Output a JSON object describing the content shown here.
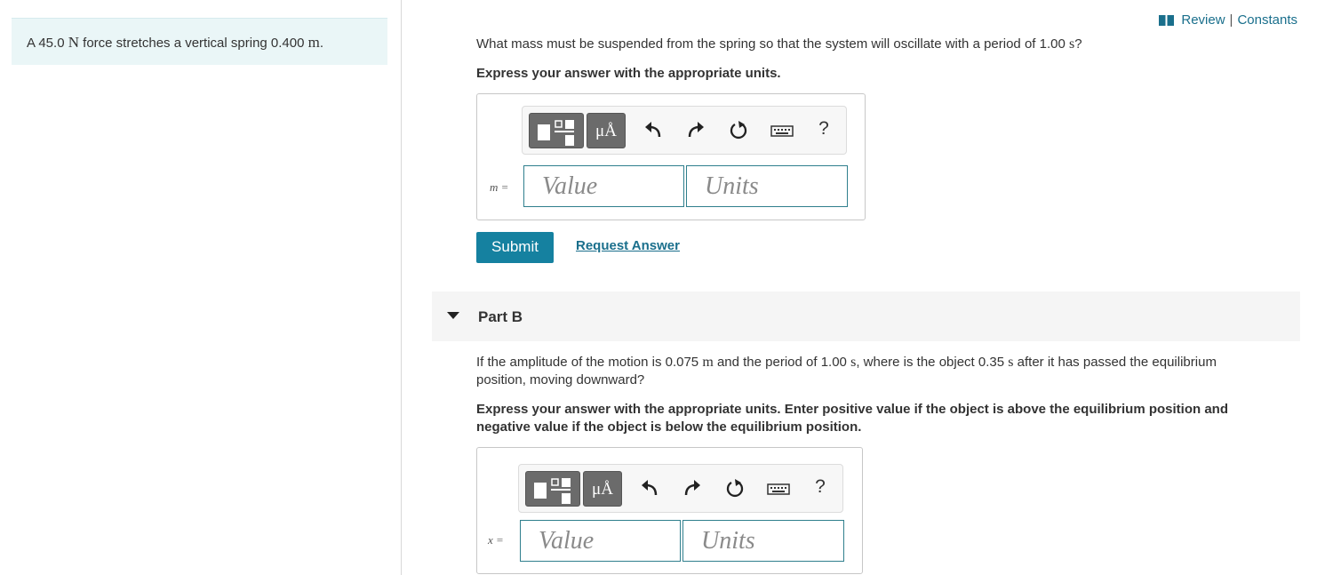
{
  "header": {
    "review_label": "Review",
    "separator": "|",
    "constants_label": "Constants"
  },
  "problem": {
    "prefix": "A 45.0 ",
    "force_unit": "N",
    "middle": " force stretches a vertical spring 0.400 ",
    "length_unit": "m",
    "suffix": "."
  },
  "part_a": {
    "question_prefix": "What mass must be suspended from the spring so that the system will oscillate with a period of 1.00 ",
    "question_unit": "s",
    "question_suffix": "?",
    "instruction": "Express your answer with the appropriate units.",
    "variable": "m =",
    "value_placeholder": "Value",
    "units_placeholder": "Units",
    "submit_label": "Submit",
    "request_label": "Request Answer"
  },
  "part_b": {
    "title": "Part B",
    "q1": "If the amplitude of the motion is 0.075 ",
    "q1_unit": "m",
    "q2": " and the period of 1.00 ",
    "q2_unit": "s",
    "q3": ", where is the object 0.35 ",
    "q3_unit": "s",
    "q4": " after it has passed the equilibrium",
    "q_line2": "position, moving downward?",
    "instruction_line1": "Express your answer with the appropriate units. Enter positive value if the object is above the equilibrium position and",
    "instruction_line2": "negative value if the object is below the equilibrium position.",
    "variable": "x =",
    "value_placeholder": "Value",
    "units_placeholder": "Units"
  },
  "toolbar": {
    "units_button_label": "μÅ",
    "help_label": "?",
    "icons": [
      "templates-icon",
      "units-icon",
      "undo-icon",
      "redo-icon",
      "reset-icon",
      "keyboard-icon",
      "help-icon"
    ]
  },
  "colors": {
    "accent": "#1581a0",
    "link": "#1a6f8c",
    "problem_bg": "#eaf6f7",
    "input_border": "#2f7f8d"
  }
}
